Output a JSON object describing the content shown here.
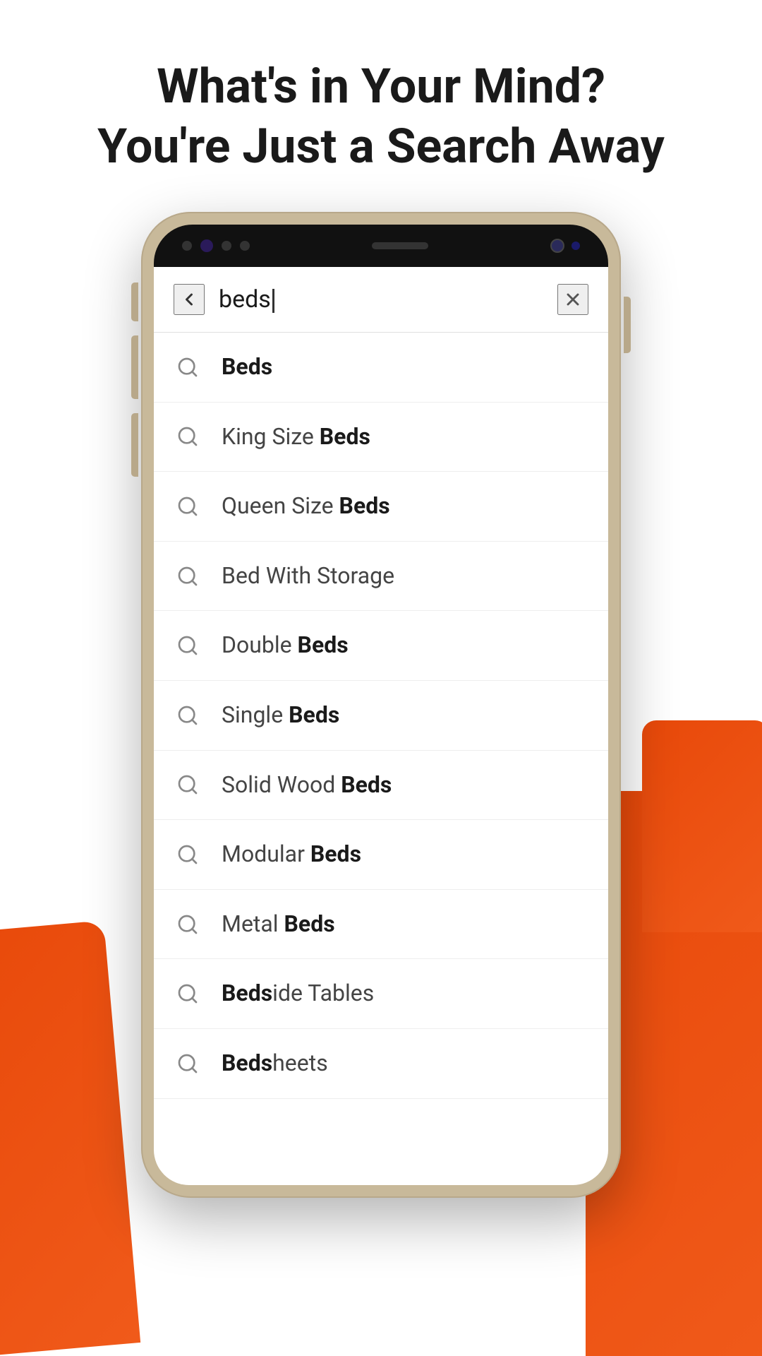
{
  "header": {
    "line1": "What's in Your Mind?",
    "line2": "You're Just a Search Away"
  },
  "search": {
    "query": "beds",
    "back_label": "back",
    "close_label": "close"
  },
  "suggestions": [
    {
      "id": 1,
      "prefix": "",
      "highlight": "Beds",
      "suffix": "",
      "full": "Beds"
    },
    {
      "id": 2,
      "prefix": "King Size ",
      "highlight": "Beds",
      "suffix": "",
      "full": "King Size Beds"
    },
    {
      "id": 3,
      "prefix": "Queen Size ",
      "highlight": "Beds",
      "suffix": "",
      "full": "Queen Size Beds"
    },
    {
      "id": 4,
      "prefix": "Bed With Storage",
      "highlight": "",
      "suffix": "",
      "full": "Bed With Storage"
    },
    {
      "id": 5,
      "prefix": "Double ",
      "highlight": "Beds",
      "suffix": "",
      "full": "Double Beds"
    },
    {
      "id": 6,
      "prefix": "Single ",
      "highlight": "Beds",
      "suffix": "",
      "full": "Single Beds"
    },
    {
      "id": 7,
      "prefix": "Solid Wood ",
      "highlight": "Beds",
      "suffix": "",
      "full": "Solid Wood Beds"
    },
    {
      "id": 8,
      "prefix": "Modular ",
      "highlight": "Beds",
      "suffix": "",
      "full": "Modular Beds"
    },
    {
      "id": 9,
      "prefix": "Metal ",
      "highlight": "Beds",
      "suffix": "",
      "full": "Metal Beds"
    },
    {
      "id": 10,
      "prefix": "",
      "highlight": "Beds",
      "suffix": "ide Tables",
      "full": "Bedside Tables"
    },
    {
      "id": 11,
      "prefix": "",
      "highlight": "Beds",
      "suffix": "heets",
      "full": "Bedsheets"
    }
  ],
  "colors": {
    "orange": "#e8490a",
    "accent": "#f05a1a",
    "text_dark": "#1a1a1a",
    "text_muted": "#888888",
    "divider": "#eeeeee"
  }
}
